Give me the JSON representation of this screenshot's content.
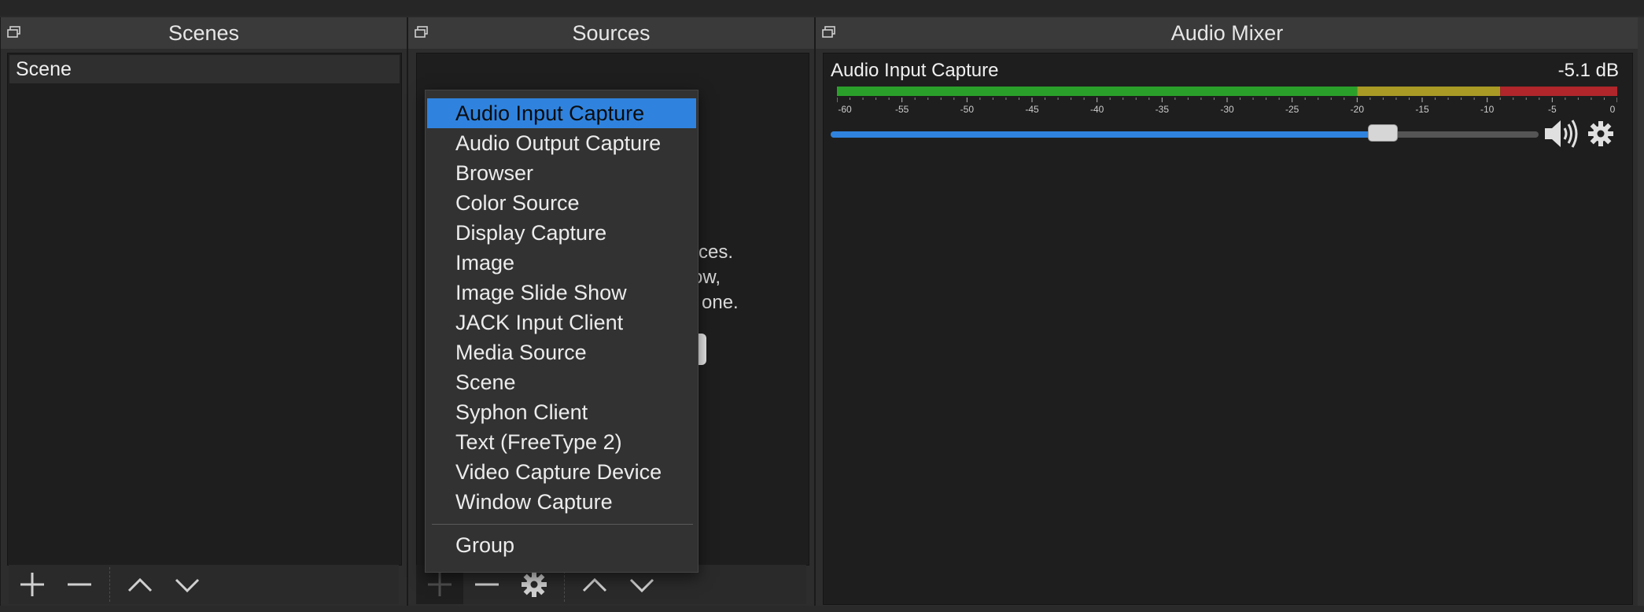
{
  "docks": {
    "scenes_title": "Scenes",
    "sources_title": "Sources",
    "mixer_title": "Audio Mixer"
  },
  "scenes": {
    "items": [
      "Scene"
    ]
  },
  "sources": {
    "hint_fragments": [
      "rces.",
      "ow,",
      "l one."
    ]
  },
  "context_menu": {
    "items": [
      "Audio Input Capture",
      "Audio Output Capture",
      "Browser",
      "Color Source",
      "Display Capture",
      "Image",
      "Image Slide Show",
      "JACK Input Client",
      "Media Source",
      "Scene",
      "Syphon Client",
      "Text (FreeType 2)",
      "Video Capture Device",
      "Window Capture"
    ],
    "group_label": "Group",
    "active_index": 0
  },
  "mixer": {
    "source_name": "Audio Input Capture",
    "level_label": "-5.1 dB",
    "scale_ticks": [
      "-60",
      "-55",
      "-50",
      "-45",
      "-40",
      "-35",
      "-30",
      "-25",
      "-20",
      "-15",
      "-10",
      "-5",
      "0"
    ],
    "volume_fraction": 0.78,
    "colors": {
      "green": "#2aa02a",
      "yellow": "#a89a25",
      "red": "#b0262b",
      "accent": "#2f83de"
    }
  }
}
